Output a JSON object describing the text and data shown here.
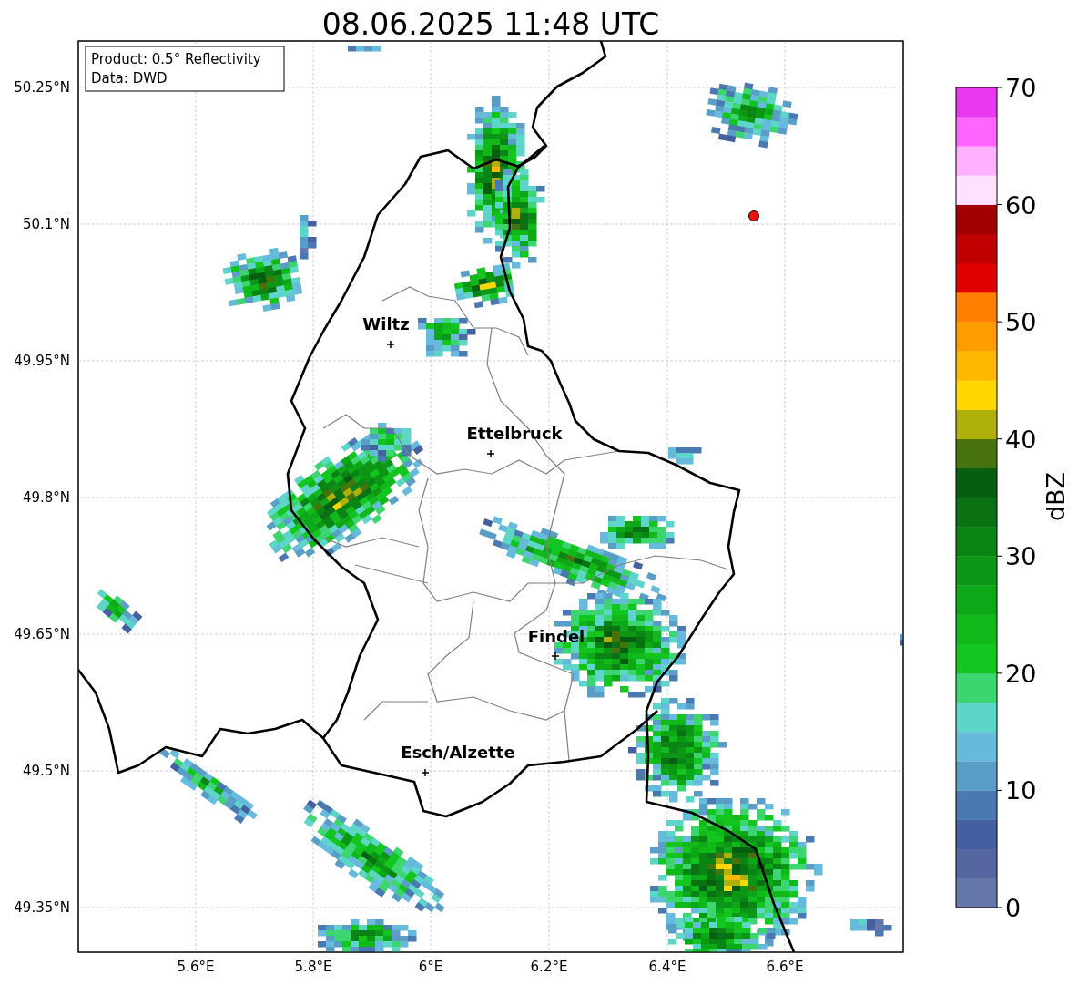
{
  "title": "08.06.2025 11:48 UTC",
  "info_box": [
    "Product: 0.5° Reflectivity",
    "Data: DWD"
  ],
  "places": [
    "Wiltz",
    "Ettelbruck",
    "Findel",
    "Esch/Alzette"
  ],
  "latitude_ticks": [
    "50.25°N",
    "50.1°N",
    "49.95°N",
    "49.8°N",
    "49.65°N",
    "49.5°N",
    "49.35°N"
  ],
  "longitude_ticks": [
    "5.6°E",
    "5.8°E",
    "6°E",
    "6.2°E",
    "6.4°E",
    "6.6°E"
  ],
  "colorbar": {
    "label": "dBZ",
    "ticks": [
      "70",
      "60",
      "50",
      "40",
      "30",
      "20",
      "10",
      "0"
    ]
  }
}
